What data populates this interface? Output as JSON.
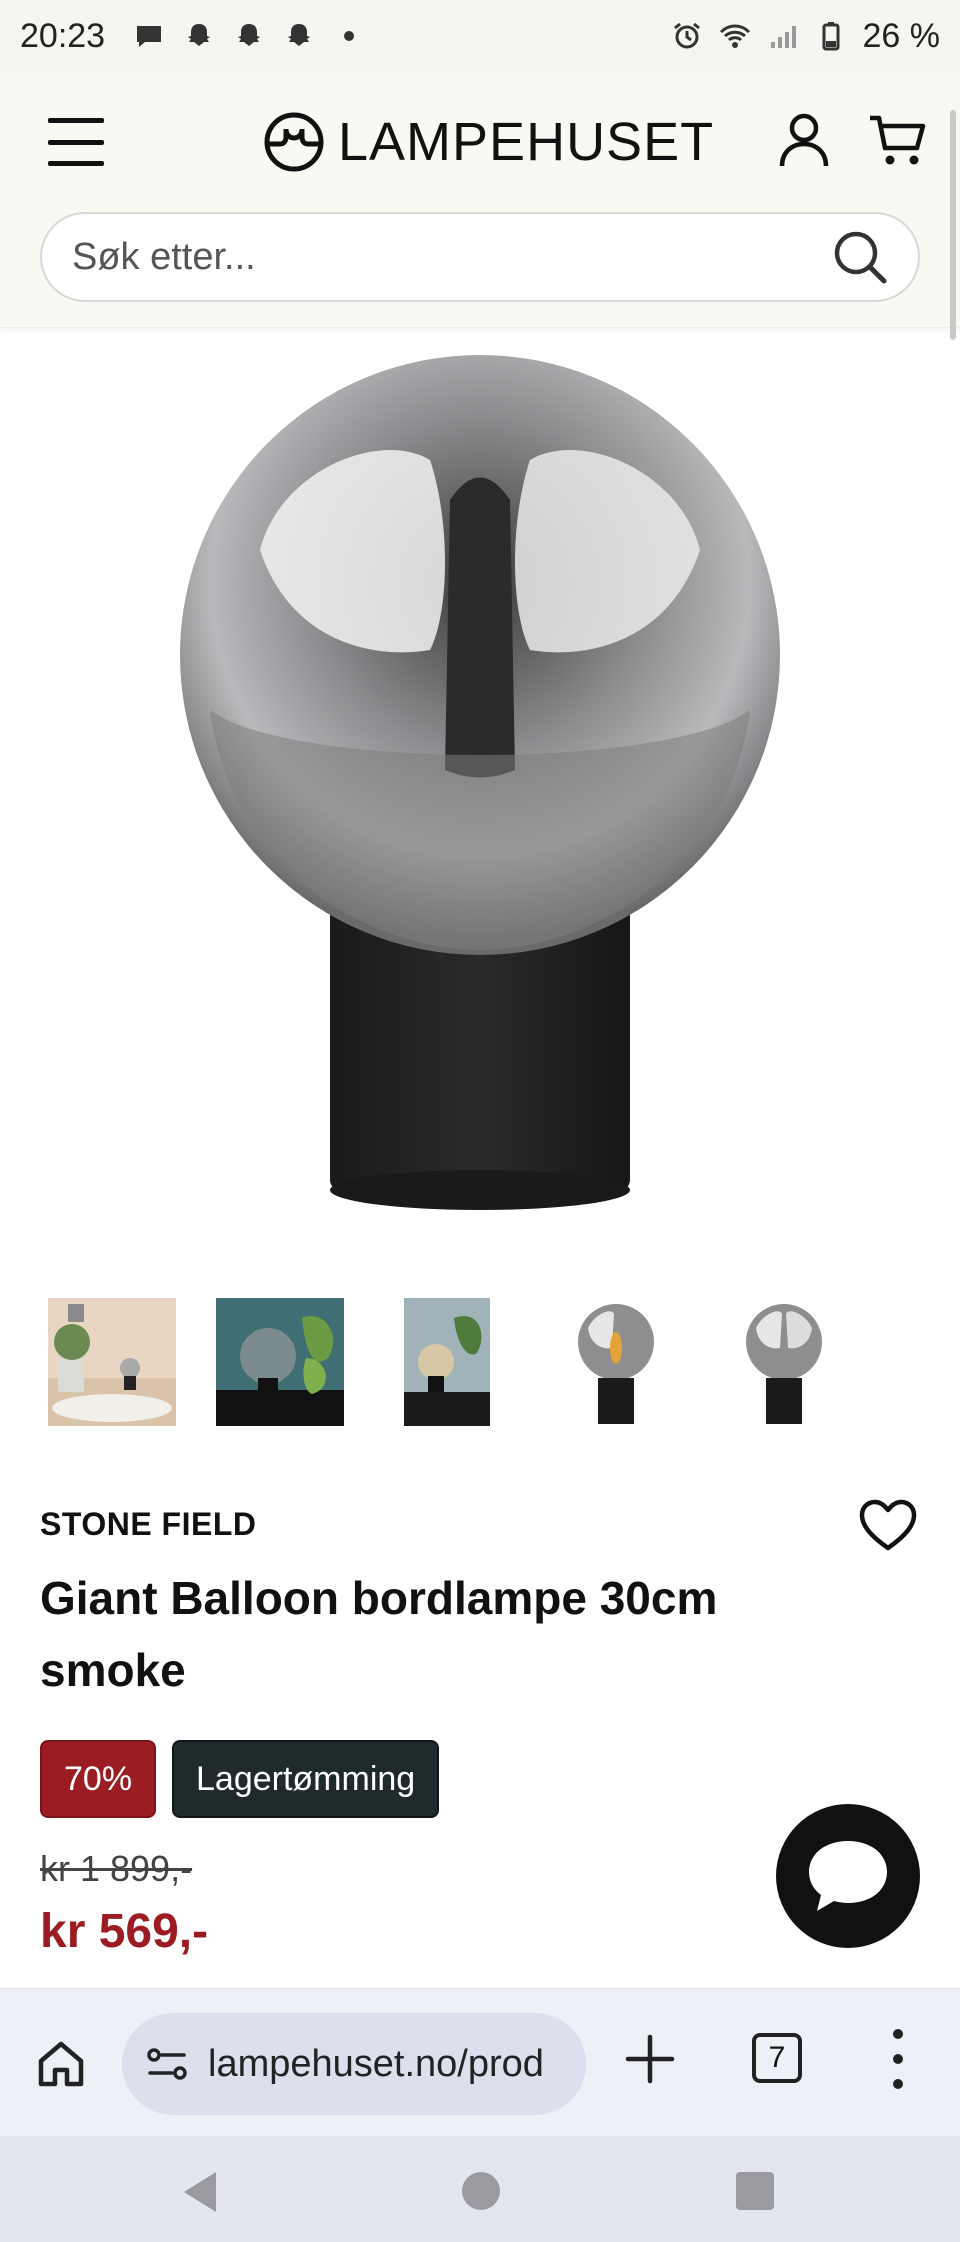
{
  "status_bar": {
    "time": "20:23",
    "battery": "26 %",
    "notification_icons": [
      "chat-bubble-icon",
      "snapchat-icon",
      "snapchat-icon",
      "snapchat-icon",
      "dot-icon"
    ],
    "system_icons": [
      "alarm-icon",
      "wifi-icon",
      "signal-icon",
      "battery-icon"
    ]
  },
  "header": {
    "logo_text": "LAMPEHUSET",
    "search_placeholder": "Søk etter..."
  },
  "product": {
    "image_alt": "Giant Balloon bordlampe 30cm smoke",
    "thumbnails": [
      "thumb-lifestyle-1",
      "thumb-lifestyle-2",
      "thumb-lifestyle-3",
      "thumb-lit",
      "thumb-product"
    ],
    "brand": "STONE FIELD",
    "title": "Giant Balloon bordlampe 30cm smoke",
    "discount_badge": "70%",
    "campaign_badge": "Lagertømming",
    "old_price": "kr 1 899,-",
    "new_price": "kr 569,-"
  },
  "browser": {
    "url": "lampehuset.no/prod",
    "tab_count": "7"
  },
  "colors": {
    "header_bg": "#faf8f3",
    "discount_red": "#9b1c22",
    "campaign_dark": "#1f2a2c",
    "price_red": "#9b1c22"
  }
}
